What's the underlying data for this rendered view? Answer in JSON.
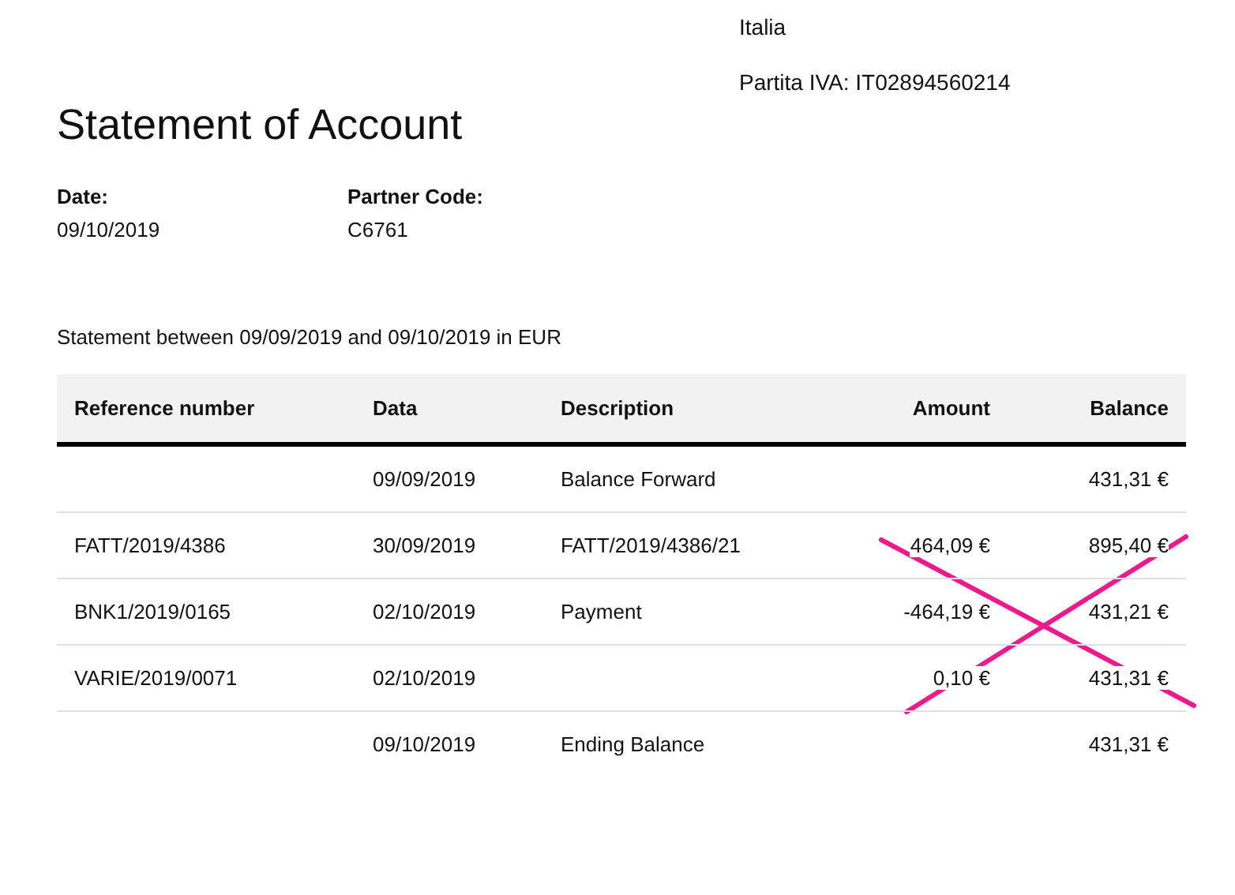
{
  "company_address": [
    "Italia"
  ],
  "vat": "Partita IVA: IT02894560214",
  "title": "Statement of Account",
  "info": [
    {
      "label": "Date:",
      "value": "09/10/2019"
    },
    {
      "label": "Partner Code:",
      "value": "C6761"
    }
  ],
  "period": "Statement between 09/09/2019 and 09/10/2019 in EUR",
  "table": {
    "columns": [
      {
        "label": "Reference number",
        "kind": "text"
      },
      {
        "label": "Data",
        "kind": "text"
      },
      {
        "label": "Description",
        "kind": "text"
      },
      {
        "label": "Amount",
        "kind": "money"
      },
      {
        "label": "Balance",
        "kind": "money"
      }
    ],
    "rows": [
      [
        "",
        "09/09/2019",
        "Balance Forward",
        "",
        "431,31 €"
      ],
      [
        "FATT/2019/4386",
        "30/09/2019",
        "FATT/2019/4386/21",
        "464,09 €",
        "895,40 €"
      ],
      [
        "BNK1/2019/0165",
        "02/10/2019",
        "Payment",
        "-464,19 €",
        "431,21 €"
      ],
      [
        "VARIE/2019/0071",
        "02/10/2019",
        "",
        "0,10 €",
        "431,31 €"
      ],
      [
        "",
        "09/10/2019",
        "Ending Balance",
        "",
        "431,31 €"
      ]
    ]
  },
  "cross_mark": {
    "color": "#f0198c"
  }
}
